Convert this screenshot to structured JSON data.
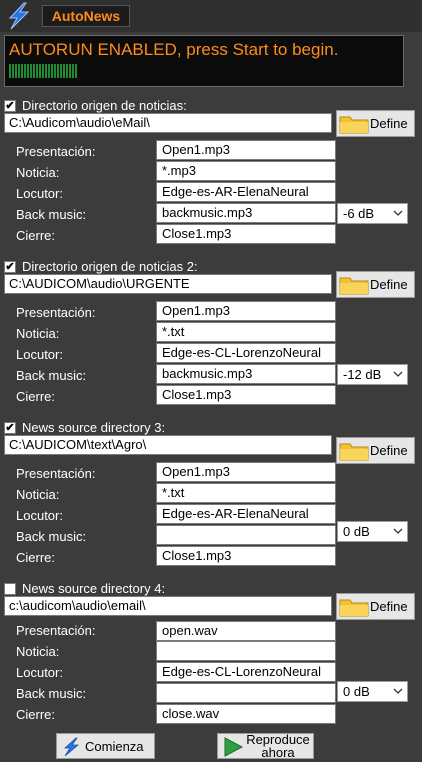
{
  "app": {
    "title": "AutoNews"
  },
  "status": {
    "message": "AUTORUN ENABLED, press Start to begin."
  },
  "labels": {
    "presentacion": "Presentación:",
    "noticia": "Noticia:",
    "locutor": "Locutor:",
    "back_music": "Back music:",
    "cierre": "Cierre:"
  },
  "define_label": "Define",
  "sections": [
    {
      "checked": true,
      "check_mark": "✔",
      "title": "Directorio origen de noticias:",
      "path": "C:\\Audicom\\audio\\eMail\\",
      "presentacion": "Open1.mp3",
      "noticia": "*.mp3",
      "locutor": "Edge-es-AR-ElenaNeural",
      "back_music": "backmusic.mp3",
      "volume": "-6 dB",
      "cierre": "Close1.mp3"
    },
    {
      "checked": true,
      "check_mark": "✔",
      "title": "Directorio origen de noticias 2:",
      "path": "C:\\AUDICOM\\audio\\URGENTE",
      "presentacion": "Open1.mp3",
      "noticia": "*.txt",
      "locutor": "Edge-es-CL-LorenzoNeural",
      "back_music": "backmusic.mp3",
      "volume": "-12 dB",
      "cierre": "Close1.mp3"
    },
    {
      "checked": true,
      "check_mark": "✔",
      "title": "News source directory 3:",
      "path": "C:\\AUDICOM\\text\\Agro\\",
      "presentacion": "Open1.mp3",
      "noticia": "*.txt",
      "locutor": "Edge-es-AR-ElenaNeural",
      "back_music": "",
      "volume": "0 dB",
      "cierre": "Close1.mp3"
    },
    {
      "checked": false,
      "check_mark": "",
      "title": "News source directory 4:",
      "path": "c:\\audicom\\audio\\email\\",
      "presentacion": "open.wav",
      "noticia": "",
      "locutor": "Edge-es-CL-LorenzoNeural",
      "back_music": "",
      "volume": "0 dB",
      "cierre": "close.wav"
    }
  ],
  "buttons": {
    "start": "Comienza",
    "play": "Reproduce ahora"
  },
  "colors": {
    "background": "#3c3c3c",
    "accent": "#ff8c1a",
    "meter": "#1f8a2e"
  },
  "icons": {
    "logo": "lightning-icon",
    "folder": "folder-icon",
    "start": "lightning-icon",
    "play": "play-icon"
  }
}
